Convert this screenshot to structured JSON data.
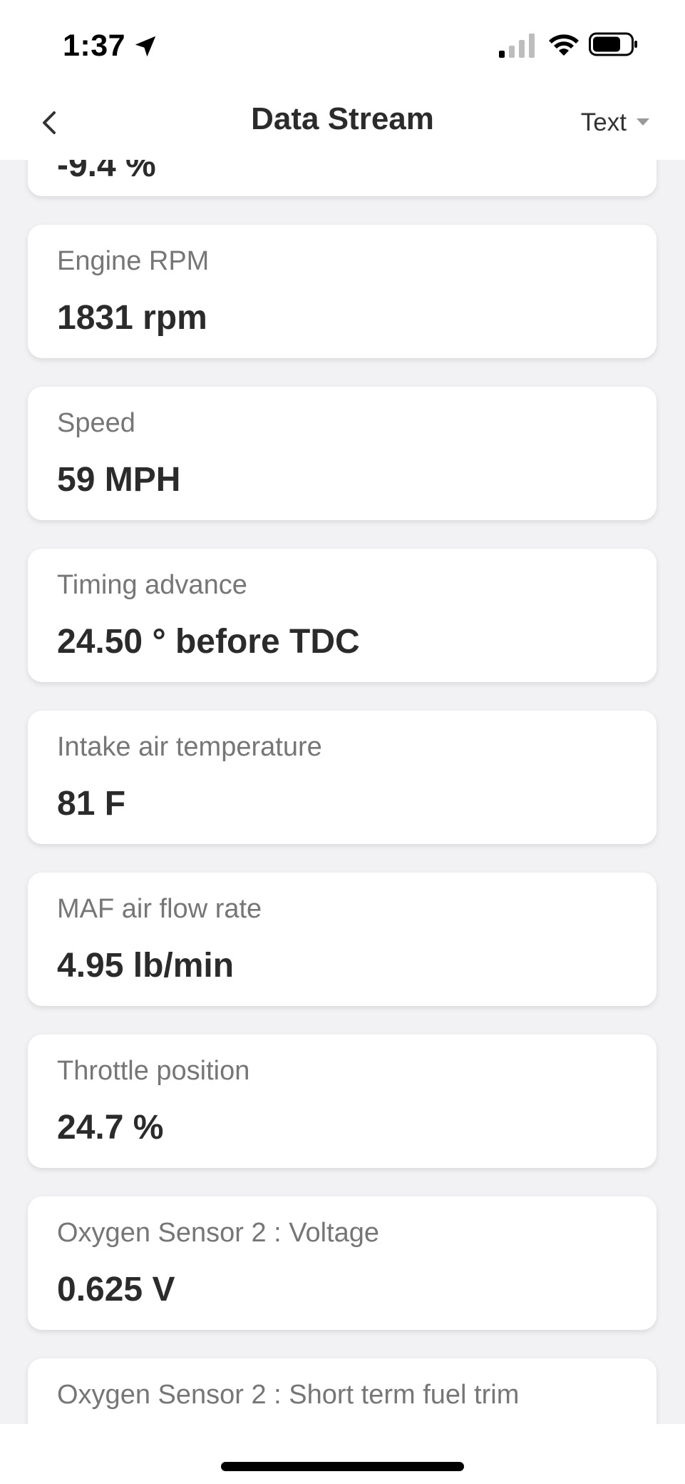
{
  "status_bar": {
    "time": "1:37",
    "icons": [
      "location-arrow-icon",
      "cellular-signal-icon",
      "wifi-icon",
      "battery-icon"
    ]
  },
  "nav": {
    "back_icon": "chevron-left-icon",
    "title": "Data Stream",
    "view_mode": "Text",
    "view_mode_icon": "caret-down-icon"
  },
  "partial_top_card": {
    "value": "-9.4 %"
  },
  "items": [
    {
      "label": "Engine RPM",
      "value": "1831 rpm"
    },
    {
      "label": "Speed",
      "value": "59 MPH"
    },
    {
      "label": "Timing advance",
      "value": "24.50 ° before TDC"
    },
    {
      "label": "Intake air temperature",
      "value": "81 F"
    },
    {
      "label": "MAF air flow rate",
      "value": "4.95 lb/min"
    },
    {
      "label": "Throttle position",
      "value": "24.7 %"
    },
    {
      "label": "Oxygen Sensor 2 : Voltage",
      "value": "0.625 V"
    },
    {
      "label": "Oxygen Sensor 2 : Short term fuel trim",
      "value": ""
    }
  ],
  "colors": {
    "background": "#f2f2f4",
    "card": "#ffffff",
    "label": "#767676",
    "value": "#2b2b2b"
  }
}
